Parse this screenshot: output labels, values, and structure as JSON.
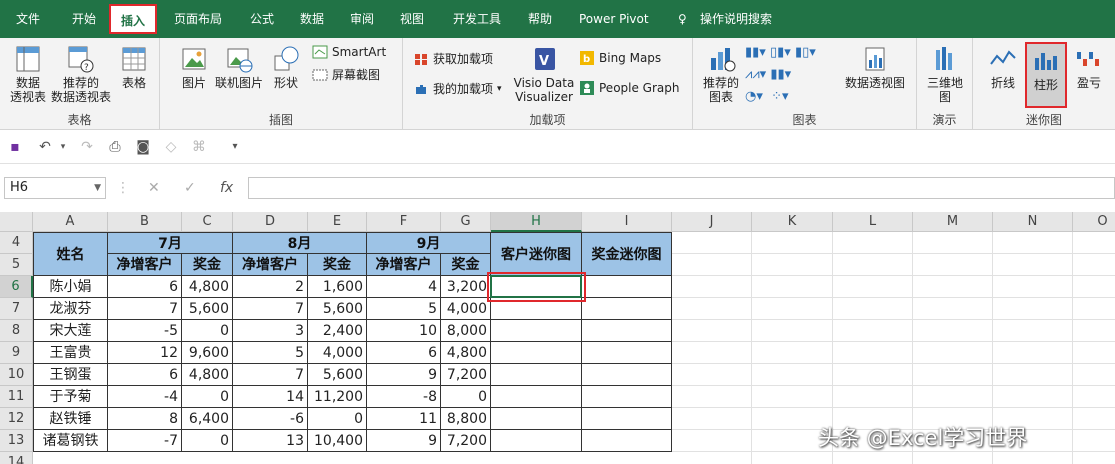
{
  "tabs": [
    "文件",
    "开始",
    "插入",
    "页面布局",
    "公式",
    "数据",
    "审阅",
    "视图",
    "开发工具",
    "帮助",
    "Power Pivot"
  ],
  "active_tab": "插入",
  "tell_me": "操作说明搜索",
  "ribbon": {
    "tables": {
      "pivot": "数据\n透视表",
      "recommended": "推荐的\n数据透视表",
      "table": "表格",
      "label": "表格"
    },
    "illustrations": {
      "pictures": "图片",
      "online": "联机图片",
      "shapes": "形状",
      "smartart": "SmartArt",
      "screenshot": "屏幕截图",
      "label": "插图"
    },
    "addins": {
      "get": "获取加载项",
      "mine": "我的加载项",
      "visio": "Visio Data\nVisualizer",
      "bing": "Bing Maps",
      "people": "People Graph",
      "label": "加载项"
    },
    "charts": {
      "recommended": "推荐的\n图表",
      "pivotchart": "数据透视图",
      "label": "图表"
    },
    "tours": {
      "map3d": "三维地\n图",
      "label": "演示"
    },
    "sparklines": {
      "line": "折线",
      "column": "柱形",
      "winloss": "盈亏",
      "label": "迷你图"
    }
  },
  "name_box": "H6",
  "fx": "fx",
  "columns": [
    "A",
    "B",
    "C",
    "D",
    "E",
    "F",
    "G",
    "H",
    "I",
    "J",
    "K",
    "L",
    "M",
    "N",
    "O"
  ],
  "header": {
    "name": "姓名",
    "months": [
      "7月",
      "8月",
      "9月"
    ],
    "sub": [
      "净增客户",
      "奖金",
      "净增客户",
      "奖金",
      "净增客户",
      "奖金"
    ],
    "spark_customer": "客户迷你图",
    "spark_bonus": "奖金迷你图"
  },
  "rows": [
    {
      "row": "6",
      "name": "陈小娟",
      "vals": [
        "6",
        "4,800",
        "2",
        "1,600",
        "4",
        "3,200"
      ]
    },
    {
      "row": "7",
      "name": "龙淑芬",
      "vals": [
        "7",
        "5,600",
        "7",
        "5,600",
        "5",
        "4,000"
      ]
    },
    {
      "row": "8",
      "name": "宋大莲",
      "vals": [
        "-5",
        "0",
        "3",
        "2,400",
        "10",
        "8,000"
      ]
    },
    {
      "row": "9",
      "name": "王富贵",
      "vals": [
        "12",
        "9,600",
        "5",
        "4,000",
        "6",
        "4,800"
      ]
    },
    {
      "row": "10",
      "name": "王钢蛋",
      "vals": [
        "6",
        "4,800",
        "7",
        "5,600",
        "9",
        "7,200"
      ]
    },
    {
      "row": "11",
      "name": "于予菊",
      "vals": [
        "-4",
        "0",
        "14",
        "11,200",
        "-8",
        "0"
      ]
    },
    {
      "row": "12",
      "name": "赵铁锤",
      "vals": [
        "8",
        "6,400",
        "-6",
        "0",
        "11",
        "8,800"
      ]
    },
    {
      "row": "13",
      "name": "诸葛钢铁",
      "vals": [
        "-7",
        "0",
        "13",
        "10,400",
        "9",
        "7,200"
      ]
    }
  ],
  "header_rows": [
    "4",
    "5"
  ],
  "extra_row": "14",
  "watermark": "头条 @Excel学习世界"
}
